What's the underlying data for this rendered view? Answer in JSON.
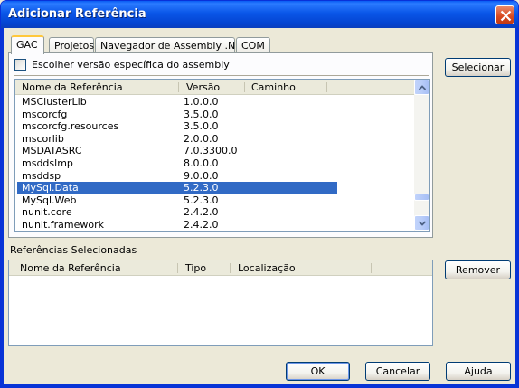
{
  "window": {
    "title": "Adicionar Referência"
  },
  "tabs": [
    {
      "label": "GAC",
      "active": true
    },
    {
      "label": "Projetos",
      "active": false
    },
    {
      "label": "Navegador de Assembly .NET",
      "active": false
    },
    {
      "label": "COM",
      "active": false
    }
  ],
  "gac": {
    "checkbox_label": "Escolher versão específica do assembly",
    "checked": false,
    "columns": [
      "Nome da Referência",
      "Versão",
      "Caminho"
    ],
    "rows": [
      {
        "name": "MSClusterLib",
        "version": "1.0.0.0"
      },
      {
        "name": "mscorcfg",
        "version": "3.5.0.0"
      },
      {
        "name": "mscorcfg.resources",
        "version": "3.5.0.0"
      },
      {
        "name": "mscorlib",
        "version": "2.0.0.0"
      },
      {
        "name": "MSDATASRC",
        "version": "7.0.3300.0"
      },
      {
        "name": "msddslmp",
        "version": "8.0.0.0"
      },
      {
        "name": "msddsp",
        "version": "9.0.0.0"
      },
      {
        "name": "MySql.Data",
        "version": "5.2.3.0",
        "selected": true
      },
      {
        "name": "MySql.Web",
        "version": "5.2.3.0"
      },
      {
        "name": "nunit.core",
        "version": "2.4.2.0"
      },
      {
        "name": "nunit.framework",
        "version": "2.4.2.0"
      }
    ]
  },
  "selected_references": {
    "label": "Referências Selecionadas",
    "columns": [
      "Nome da Referência",
      "Tipo",
      "Localização"
    ]
  },
  "buttons": {
    "select": "Selecionar",
    "remove": "Remover",
    "ok": "OK",
    "cancel": "Cancelar",
    "help": "Ajuda"
  },
  "colors": {
    "titlebar": "#0a56e8",
    "selection": "#316ac5",
    "window_bg": "#ece9d8",
    "close_button": "#d8491f"
  },
  "icons": {
    "close": "close-icon",
    "scroll_up": "scroll-up-arrow-icon",
    "scroll_down": "scroll-down-arrow-icon"
  }
}
